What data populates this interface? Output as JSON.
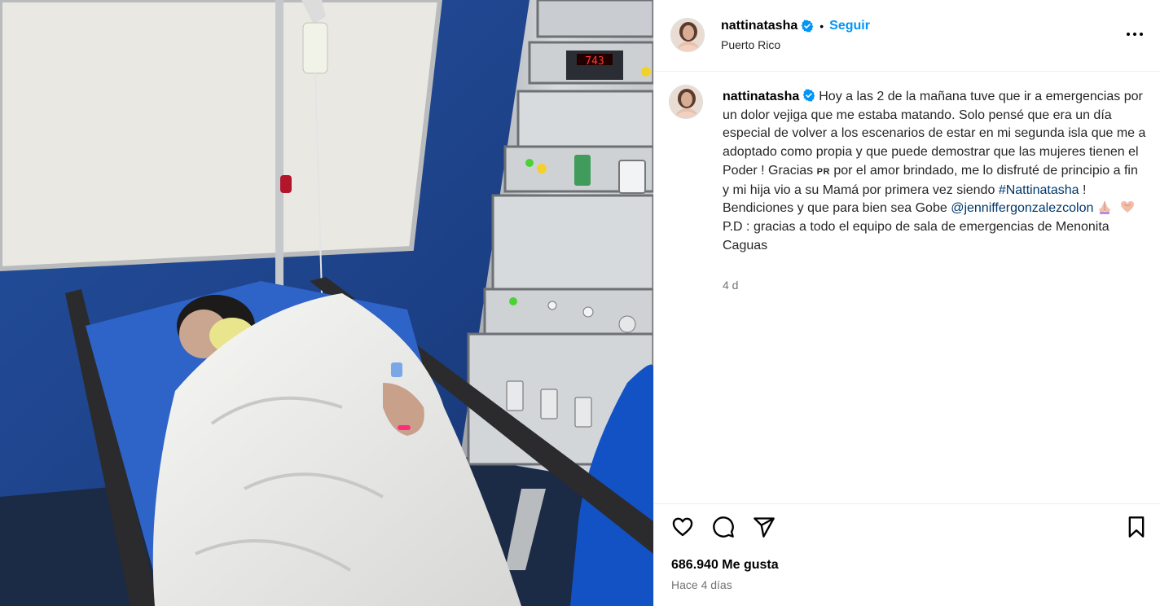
{
  "post": {
    "username": "nattinatasha",
    "follow_label": "Seguir",
    "separator": "•",
    "location": "Puerto Rico"
  },
  "caption": {
    "username": "nattinatasha",
    "text_part1": "Hoy a las 2 de la mañana tuve que ir a emergencias por un dolor vejiga que me estaba matando. Solo pensé que era un día especial de volver a los escenarios de estar en mi segunda isla que me a adoptado como propia y que puede demostrar que las mujeres tienen el Poder ! Gracias",
    "pr_small": "PR",
    "text_part2": "por el amor brindado, me lo disfruté de principio a fin y mi hija vio a su Mamá por primera vez siendo",
    "hashtag": "#Nattinatasha",
    "text_part3": "! Bendiciones y que para bien sea Gobe",
    "mention": "@jenniffergonzalezcolon",
    "text_part4": "P.D : gracias a todo el equipo de sala de emergencias de Menonita Caguas",
    "time": "4 d"
  },
  "actions": {
    "likes": "686.940 Me gusta",
    "ago": "Hace 4 días",
    "icons": [
      "heart-icon",
      "comment-icon",
      "share-icon",
      "bookmark-icon"
    ]
  },
  "photo": {
    "monitor_readout": "743"
  },
  "colors": {
    "accent": "#0095f6",
    "link": "#00376b",
    "verified": "#0095f6",
    "muted": "#737373",
    "text": "#262626"
  }
}
